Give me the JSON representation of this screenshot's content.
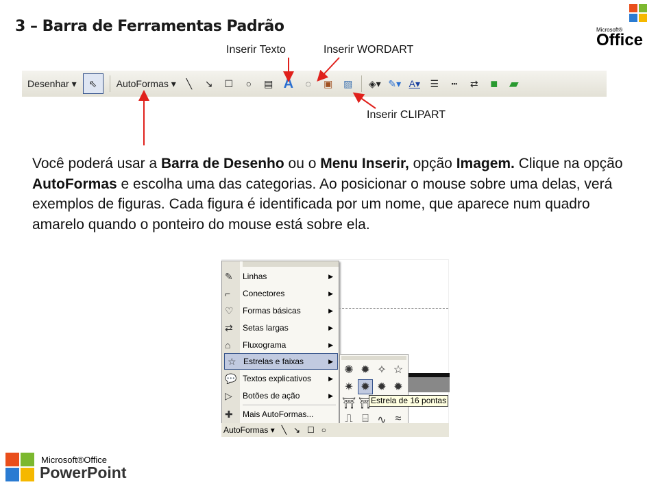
{
  "title": "3 – Barra de Ferramentas Padrão",
  "callouts": {
    "insert_text": "Inserir Texto",
    "insert_wordart": "Inserir WORDART",
    "insert_clipart": "Inserir CLIPART"
  },
  "toolbar": {
    "draw": "Desenhar ▾",
    "autoshapes": "AutoFormas ▾",
    "icons": [
      "select-arrow",
      "line",
      "arrow",
      "rectangle",
      "oval",
      "text-box",
      "wordart",
      "diagram",
      "clipart",
      "picture",
      "fill-color",
      "line-color",
      "font-color",
      "line-style",
      "dash-style",
      "arrow-style",
      "shadow",
      "3d"
    ]
  },
  "paragraph": {
    "p1": "Você poderá usar a ",
    "b1": "Barra de Desenho",
    "p2": " ou o ",
    "b2": "Menu Inserir,",
    "p3": " opção ",
    "b3": "Imagem.",
    "p4": "Clique na opção ",
    "b4": "AutoFormas",
    "p5": " e escolha uma das categorias. Ao posicionar o mouse sobre uma delas, verá exemplos de figuras. Cada figura é identificada por um nome, que aparece num quadro amarelo quando o ponteiro do mouse está sobre ela."
  },
  "menu": {
    "items": [
      "Linhas",
      "Conectores",
      "Formas básicas",
      "Setas largas",
      "Fluxograma",
      "Estrelas e faixas",
      "Textos explicativos",
      "Botões de ação",
      "Mais AutoFormas..."
    ],
    "highlighted": "Estrelas e faixas"
  },
  "tooltip": "Estrela de 16 pontas",
  "bottom_bar": {
    "autoshapes": "AutoFormas ▾"
  },
  "logos": {
    "office": "Microsoft Office",
    "powerpoint": "Microsoft Office PowerPoint"
  },
  "colors": {
    "arrow": "#e0201b",
    "highlight": "#c1cae0",
    "tooltip": "#ffffe1"
  }
}
